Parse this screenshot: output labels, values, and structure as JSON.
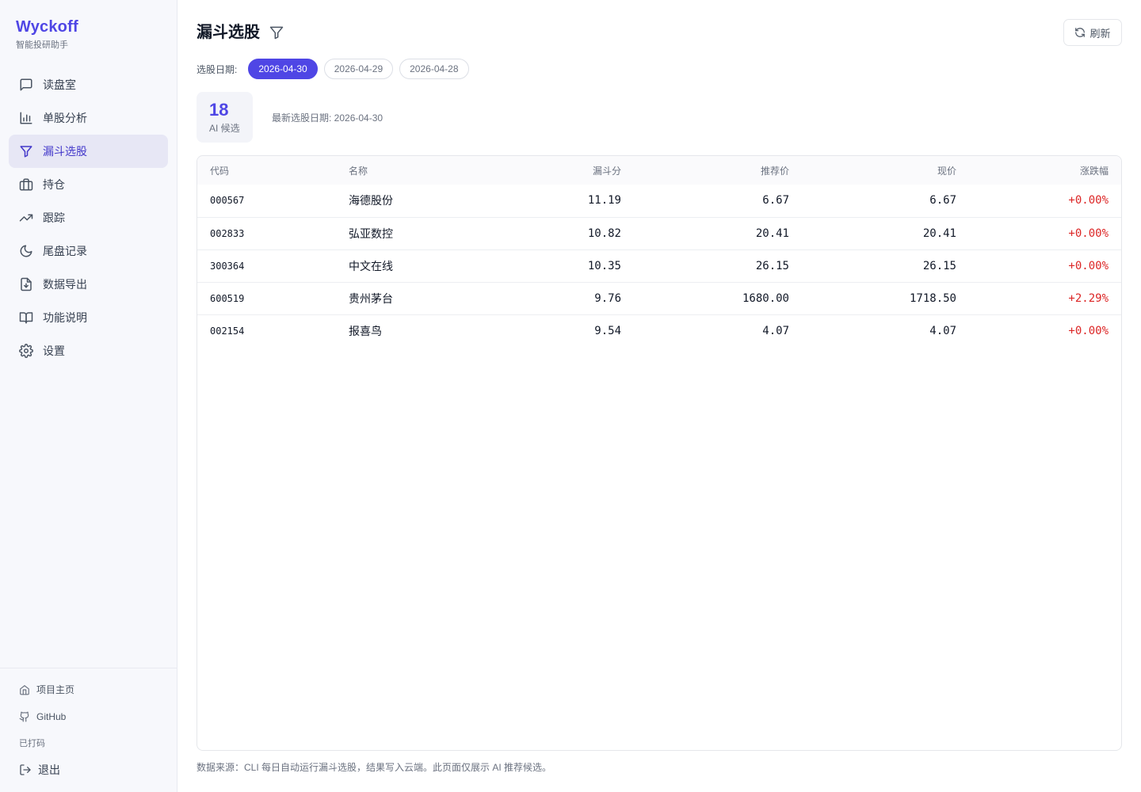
{
  "brand": {
    "name": "Wyckoff",
    "subtitle": "智能投研助手"
  },
  "nav": [
    {
      "label": "读盘室",
      "icon": "chat-icon"
    },
    {
      "label": "单股分析",
      "icon": "bar-chart-icon"
    },
    {
      "label": "漏斗选股",
      "icon": "funnel-icon",
      "active": true
    },
    {
      "label": "持仓",
      "icon": "briefcase-icon"
    },
    {
      "label": "跟踪",
      "icon": "trending-up-icon"
    },
    {
      "label": "尾盘记录",
      "icon": "moon-icon"
    },
    {
      "label": "数据导出",
      "icon": "file-download-icon"
    },
    {
      "label": "功能说明",
      "icon": "book-icon"
    },
    {
      "label": "设置",
      "icon": "gear-icon"
    }
  ],
  "footer": {
    "home_label": "项目主页",
    "github_label": "GitHub",
    "status": "已打码",
    "logout_label": "退出"
  },
  "page": {
    "title": "漏斗选股",
    "refresh_label": "刷新",
    "date_label": "选股日期:",
    "dates": [
      "2026-04-30",
      "2026-04-29",
      "2026-04-28"
    ],
    "selected_date": "2026-04-30",
    "stat_count": "18",
    "stat_label": "AI 候选",
    "latest_text": "最新选股日期: 2026-04-30",
    "footnote": "数据来源：CLI 每日自动运行漏斗选股，结果写入云端。此页面仅展示 AI 推荐候选。"
  },
  "table": {
    "headers": [
      "代码",
      "名称",
      "漏斗分",
      "推荐价",
      "现价",
      "涨跌幅"
    ],
    "rows": [
      {
        "code": "000567",
        "name": "海德股份",
        "score": "11.19",
        "rec": "6.67",
        "cur": "6.67",
        "chg": "+0.00%"
      },
      {
        "code": "002833",
        "name": "弘亚数控",
        "score": "10.82",
        "rec": "20.41",
        "cur": "20.41",
        "chg": "+0.00%"
      },
      {
        "code": "300364",
        "name": "中文在线",
        "score": "10.35",
        "rec": "26.15",
        "cur": "26.15",
        "chg": "+0.00%"
      },
      {
        "code": "600519",
        "name": "贵州茅台",
        "score": "9.76",
        "rec": "1680.00",
        "cur": "1718.50",
        "chg": "+2.29%"
      },
      {
        "code": "002154",
        "name": "报喜鸟",
        "score": "9.54",
        "rec": "4.07",
        "cur": "4.07",
        "chg": "+0.00%"
      }
    ]
  },
  "colors": {
    "accent": "#4f46e5",
    "up": "#dc2626"
  }
}
